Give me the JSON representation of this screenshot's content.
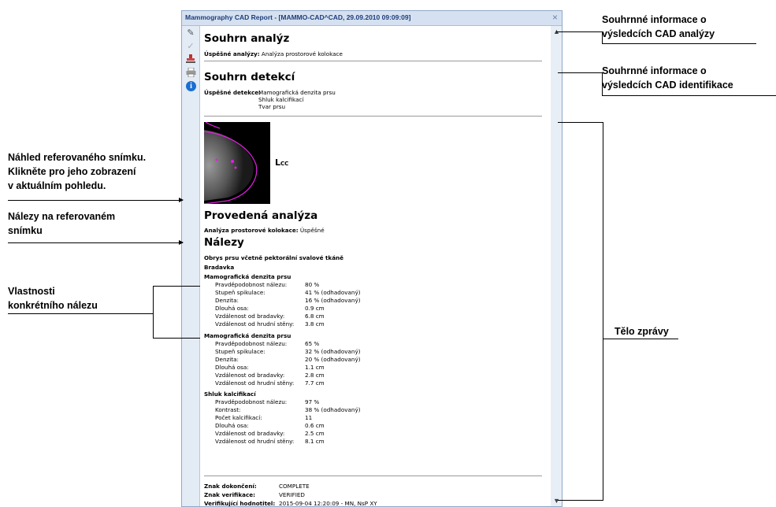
{
  "window": {
    "title": "Mammography CAD Report - [MAMMO-CAD^CAD, 29.09.2010 09:09:09]",
    "close": "×"
  },
  "summary_analysis": {
    "heading": "Souhrn analýz",
    "label": "Úspěšné analýzy:",
    "value": "Analýza prostorové kolokace"
  },
  "summary_detection": {
    "heading": "Souhrn detekcí",
    "label": "Úspěšné detekce:",
    "values": [
      "Mamografická denzita prsu",
      "Shluk kalcifikací",
      "Tvar prsu"
    ]
  },
  "thumbnail": {
    "view": "L",
    "view_sub": "CC"
  },
  "performed": {
    "heading": "Provedená analýza",
    "label": "Analýza prostorové kolokace:",
    "value": "Úspěšné"
  },
  "findings": {
    "heading": "Nálezy",
    "item1": "Obrys prsu včetně pektorální svalové tkáně",
    "item2": "Bradavka",
    "groups": [
      {
        "title": "Mamografická denzita prsu",
        "rows": [
          [
            "Pravděpodobnost nálezu:",
            "80 %"
          ],
          [
            "Stupeň spikulace:",
            "41 % (odhadovaný)"
          ],
          [
            "Denzita:",
            "16 % (odhadovaný)"
          ],
          [
            "Dlouhá osa:",
            "0.9 cm"
          ],
          [
            "Vzdálenost od bradavky:",
            "6.8 cm"
          ],
          [
            "Vzdálenost od hrudní stěny:",
            "3.8 cm"
          ]
        ]
      },
      {
        "title": "Mamografická denzita prsu",
        "rows": [
          [
            "Pravděpodobnost nálezu:",
            "65 %"
          ],
          [
            "Stupeň spikulace:",
            "32 % (odhadovaný)"
          ],
          [
            "Denzita:",
            "20 % (odhadovaný)"
          ],
          [
            "Dlouhá osa:",
            "1.1 cm"
          ],
          [
            "Vzdálenost od bradavky:",
            "2.8 cm"
          ],
          [
            "Vzdálenost od hrudní stěny:",
            "7.7 cm"
          ]
        ]
      },
      {
        "title": "Shluk kalcifikací",
        "rows": [
          [
            "Pravděpodobnost nálezu:",
            "97 %"
          ],
          [
            "Kontrast:",
            "38 % (odhadovaný)"
          ],
          [
            "Počet kalcifikací:",
            "11"
          ],
          [
            "Dlouhá osa:",
            "0.6 cm"
          ],
          [
            "Vzdálenost od bradavky:",
            "2.5 cm"
          ],
          [
            "Vzdálenost od hrudní stěny:",
            "8.1 cm"
          ]
        ]
      }
    ]
  },
  "footer": {
    "rows": [
      [
        "Znak dokončení:",
        "COMPLETE"
      ],
      [
        "Znak verifikace:",
        "VERIFIED"
      ],
      [
        "Verifikující hodnotitel:",
        "2015-09-04 12:20:09 - MN, NsP XY"
      ]
    ]
  },
  "annotations": {
    "summary_analysis": [
      "Souhrnné informace o",
      "výsledcích CAD analýzy"
    ],
    "summary_detection": [
      "Souhrnné informace o",
      "výsledcích CAD identifikace"
    ],
    "thumbnail": [
      "Náhled referovaného snímku.",
      "Klikněte pro jeho zobrazení",
      "v aktuálním pohledu."
    ],
    "findings_on_image": [
      "Nálezy na referovaném",
      "snímku"
    ],
    "properties": [
      "Vlastnosti",
      "konkrétního nálezu"
    ],
    "body": "Tělo zprávy"
  },
  "colors": {
    "accent_magenta": "#e020e0",
    "title_blue": "#1f3d7a",
    "info_blue": "#1a6fd0"
  },
  "icons": [
    "pencil-icon",
    "check-icon",
    "stamp-icon",
    "printer-icon",
    "info-icon",
    "close-icon",
    "scroll-up-icon",
    "scroll-down-icon"
  ]
}
